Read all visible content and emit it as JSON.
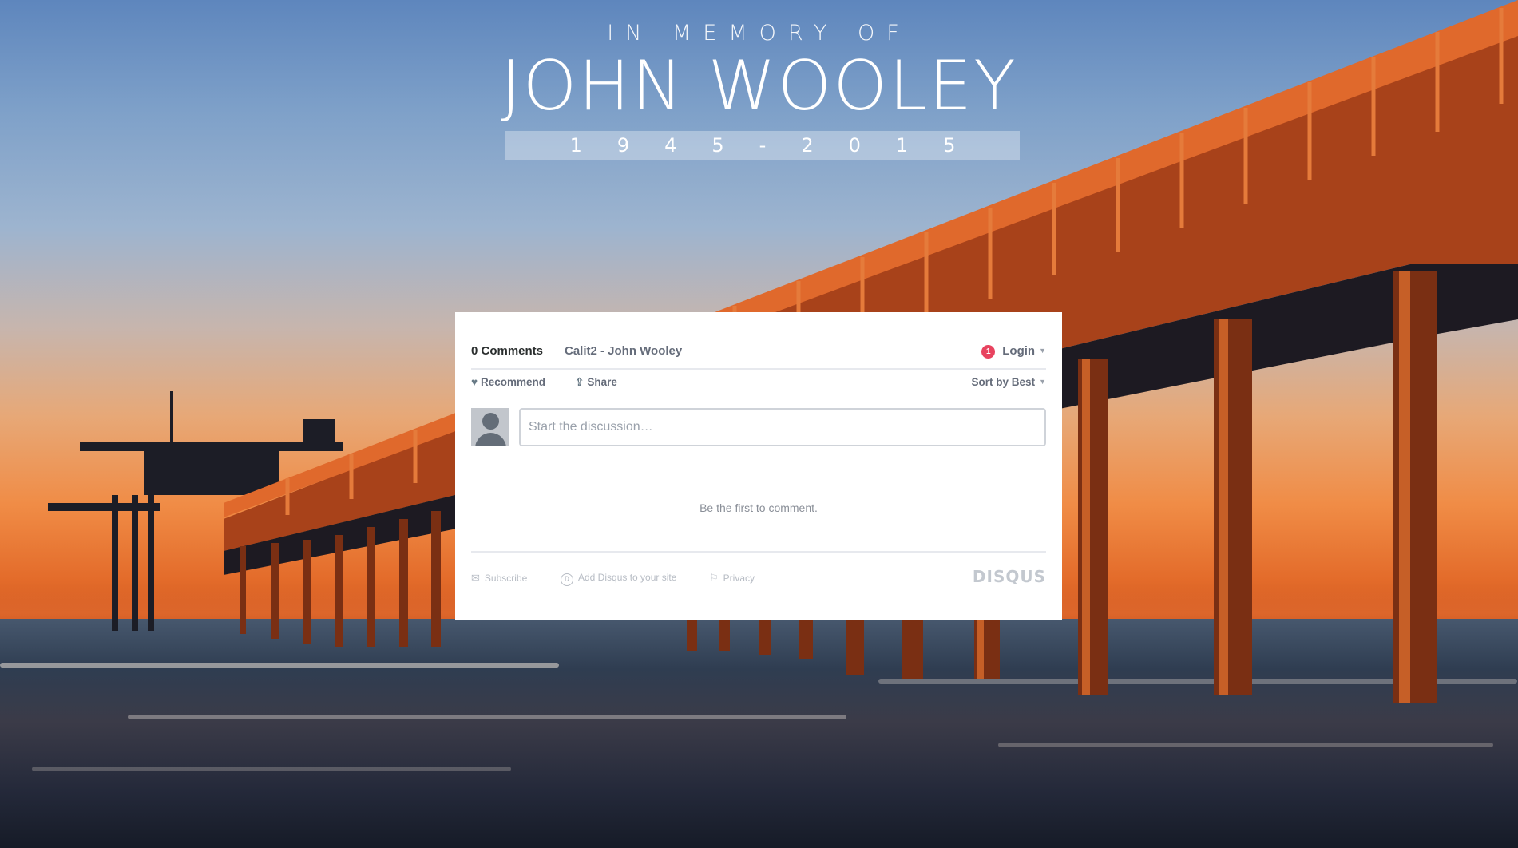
{
  "header": {
    "subtitle": "IN MEMORY OF",
    "name": "JOHN WOOLEY",
    "years": "1945-2015"
  },
  "comments": {
    "count_label": "0 Comments",
    "forum_name": "Calit2 - John Wooley",
    "notification_count": "1",
    "login_label": "Login",
    "recommend_label": "Recommend",
    "share_label": "Share",
    "sort_label": "Sort by Best",
    "input_placeholder": "Start the discussion…",
    "empty_message": "Be the first to comment.",
    "footer": {
      "subscribe_label": "Subscribe",
      "add_disqus_label": "Add Disqus to your site",
      "privacy_label": "Privacy",
      "brand": "DISQUS"
    }
  },
  "colors": {
    "notification_badge": "#e8435f",
    "pier": "#d95a23",
    "panel_bg": "#ffffff"
  }
}
